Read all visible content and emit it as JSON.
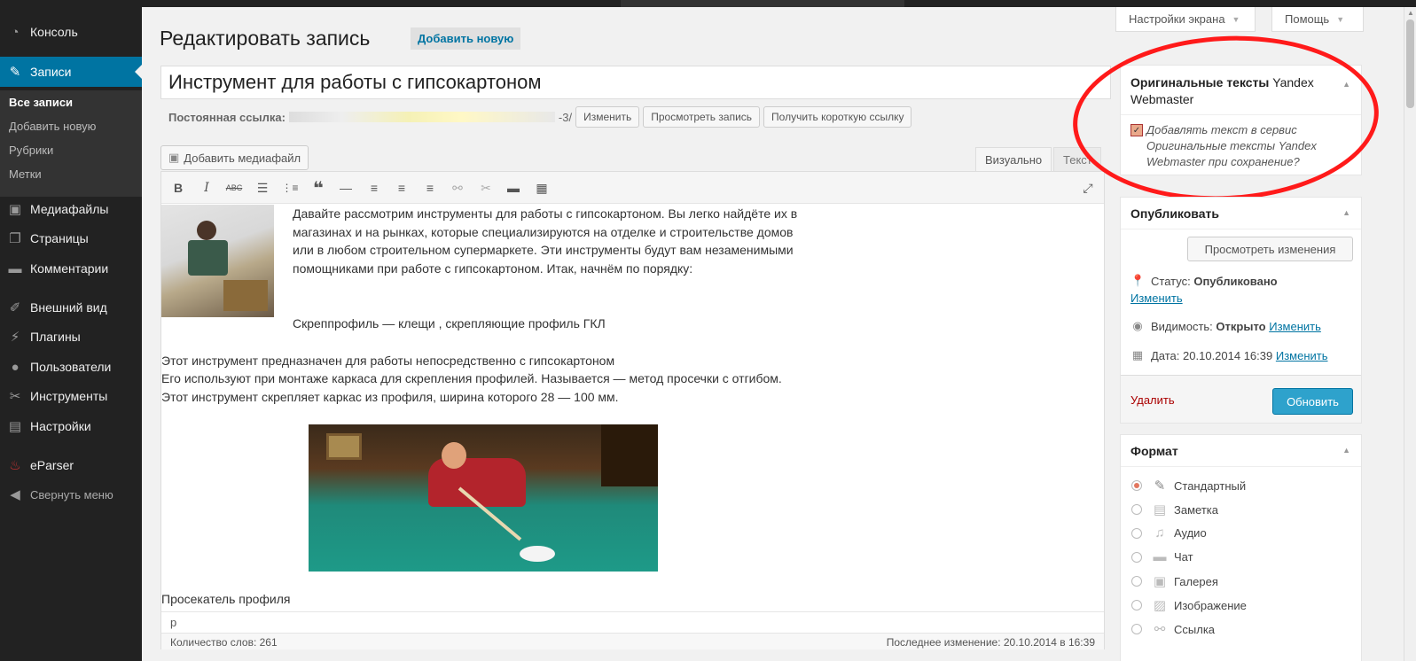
{
  "sidebar": {
    "items": [
      {
        "label": "Консоль",
        "icon": "dashboard-icon"
      },
      {
        "label": "Записи",
        "icon": "pin-icon"
      },
      {
        "label": "Медиафайлы",
        "icon": "media-icon"
      },
      {
        "label": "Страницы",
        "icon": "pages-icon"
      },
      {
        "label": "Комментарии",
        "icon": "comment-icon"
      },
      {
        "label": "Внешний вид",
        "icon": "brush-icon"
      },
      {
        "label": "Плагины",
        "icon": "plugin-icon"
      },
      {
        "label": "Пользователи",
        "icon": "user-icon"
      },
      {
        "label": "Инструменты",
        "icon": "wrench-icon"
      },
      {
        "label": "Настройки",
        "icon": "settings-icon"
      },
      {
        "label": "eParser",
        "icon": "eparser-icon"
      },
      {
        "label": "Свернуть меню",
        "icon": "collapse-icon"
      }
    ],
    "submenu": [
      "Все записи",
      "Добавить новую",
      "Рубрики",
      "Метки"
    ]
  },
  "header": {
    "screen_options": "Настройки экрана",
    "help": "Помощь",
    "page_title": "Редактировать запись",
    "add_new": "Добавить новую"
  },
  "post": {
    "title": "Инструмент для работы с гипсокартоном",
    "permalink_label": "Постоянная ссылка:",
    "permalink_slug": "-3/",
    "btn_edit": "Изменить",
    "btn_view": "Просмотреть запись",
    "btn_shortlink": "Получить короткую ссылку"
  },
  "editor": {
    "add_media": "Добавить медиафайл",
    "tab_visual": "Визуально",
    "tab_text": "Текст",
    "paragraphs": [
      "Давайте рассмотрим инструменты для работы с гипсокартоном. Вы легко найдёте их в магазинах и на рынках, которые специализируются на отделке и строительстве домов или в любом строительном супермаркете. Эти инструменты будут вам незаменимыми помощниками при работе с гипсокартоном. Итак, начнём по порядку:",
      "Скреппрофиль — клещи , скрепляющие профиль ГКЛ",
      "Этот инструмент предназначен для работы непосредственно с гипсокартоном",
      "Его используют при монтаже каркаса для скрепления профилей. Называется — метод просечки с отгибом. Этот инструмент скрепляет каркас из профиля,  ширина которого 28 — 100 мм.",
      "Просекатель профиля"
    ],
    "path": "p",
    "word_count": "Количество слов: 261",
    "last_modified": "Последнее изменение: 20.10.2014 в 16:39"
  },
  "yandex_box": {
    "title_bold": "Оригинальные тексты",
    "title_rest": " Yandex Webmaster",
    "checkbox_label": "Добавлять текст в сервис Оригинальные тексты Yandex Webmaster при сохранение?",
    "checked": true
  },
  "publish_box": {
    "title": "Опубликовать",
    "preview": "Просмотреть изменения",
    "status_label": "Статус:",
    "status_value": "Опубликовано",
    "status_edit": "Изменить",
    "visibility_label": "Видимость:",
    "visibility_value": "Открыто",
    "visibility_edit": "Изменить",
    "date_label": "Дата:",
    "date_value": "20.10.2014 16:39",
    "date_edit": "Изменить",
    "delete": "Удалить",
    "update": "Обновить"
  },
  "format_box": {
    "title": "Формат",
    "options": [
      {
        "label": "Стандартный",
        "icon": "pin-icon",
        "selected": true
      },
      {
        "label": "Заметка",
        "icon": "note-icon",
        "selected": false
      },
      {
        "label": "Аудио",
        "icon": "audio-icon",
        "selected": false
      },
      {
        "label": "Чат",
        "icon": "chat-icon",
        "selected": false
      },
      {
        "label": "Галерея",
        "icon": "gallery-icon",
        "selected": false
      },
      {
        "label": "Изображение",
        "icon": "image-icon",
        "selected": false
      },
      {
        "label": "Ссылка",
        "icon": "link-icon",
        "selected": false
      }
    ]
  },
  "colors": {
    "sidebar_bg": "#222222",
    "active_menu": "#0074a2",
    "primary_button": "#2ea2cc",
    "annotation_circle": "#ff1a1a",
    "delete_link": "#a00000"
  }
}
